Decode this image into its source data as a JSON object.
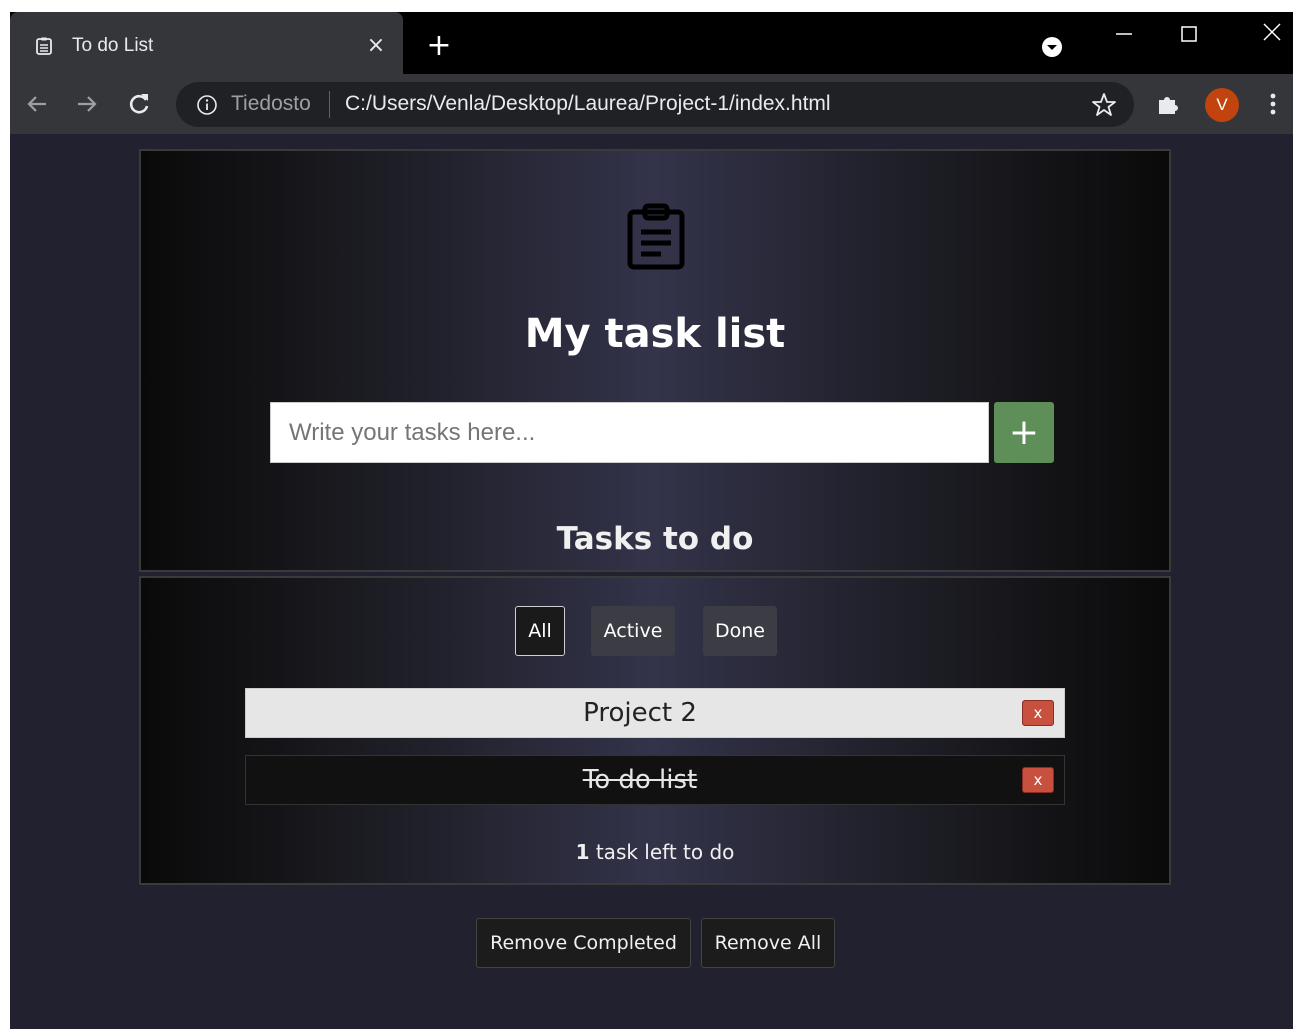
{
  "browser": {
    "tab_title": "To do List",
    "tab_close": "×",
    "new_tab": "+",
    "scheme_label": "Tiedosto",
    "url": "C:/Users/Venla/Desktop/Laurea/Project-1/index.html",
    "avatar_letter": "V",
    "avatar_color": "#c1440e"
  },
  "app": {
    "title": "My task list",
    "input_placeholder": "Write your tasks here...",
    "add_label": "+",
    "section_title": "Tasks to do",
    "filters": [
      {
        "label": "All",
        "active": true
      },
      {
        "label": "Active",
        "active": false
      },
      {
        "label": "Done",
        "active": false
      }
    ],
    "tasks": [
      {
        "text": "Project 2",
        "done": false,
        "delete_label": "x"
      },
      {
        "text": "To do list",
        "done": true,
        "delete_label": "x"
      }
    ],
    "counter": {
      "count": "1",
      "suffix": "task left to do"
    },
    "remove_completed_label": "Remove Completed",
    "remove_all_label": "Remove All",
    "accent_add": "#5e8f59",
    "accent_delete": "#c8503e"
  }
}
